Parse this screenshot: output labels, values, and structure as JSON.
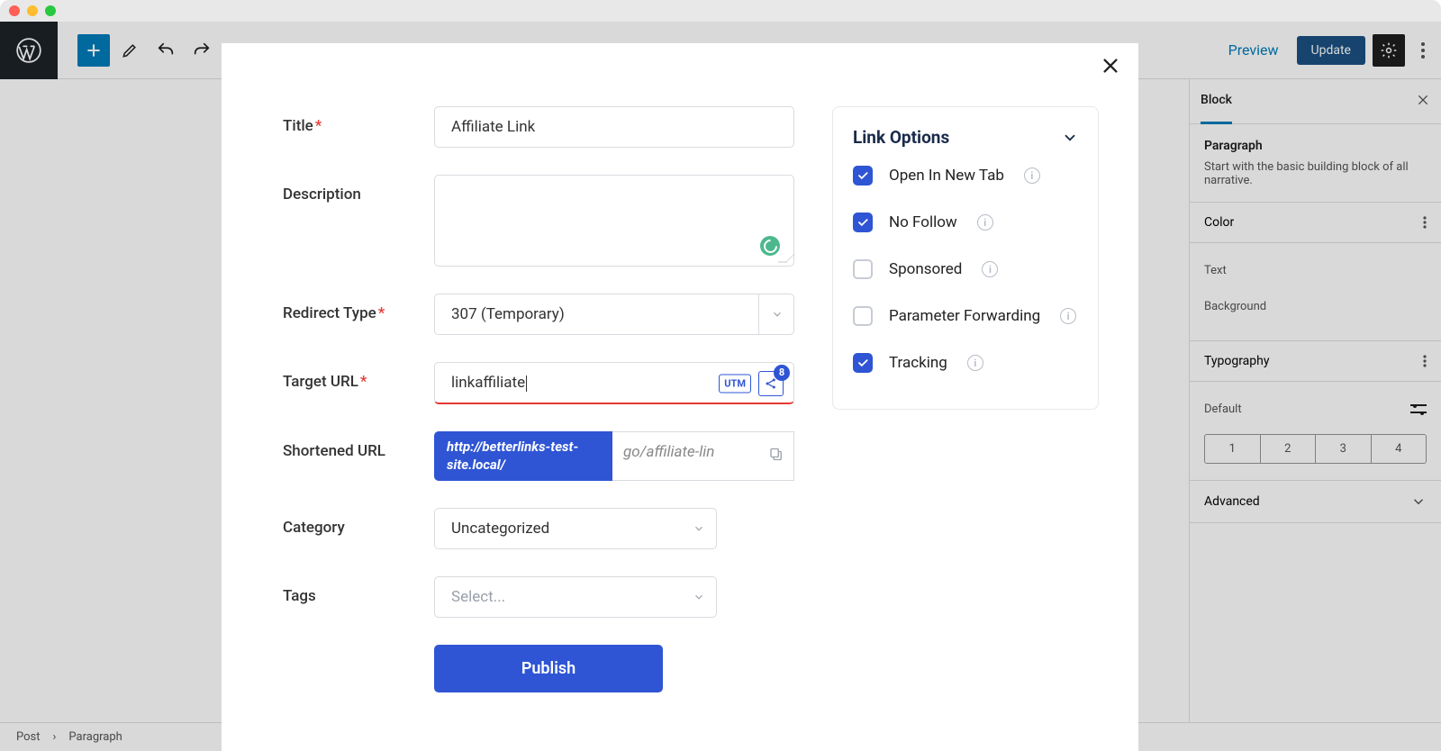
{
  "mac": {},
  "toolbar": {
    "preview": "Preview",
    "update": "Update"
  },
  "sidebar": {
    "tab": "Block",
    "block_title": "Paragraph",
    "block_desc": "Start with the basic building block of all narrative.",
    "panel_color": "Color",
    "color_text": "Text",
    "color_bg": "Background",
    "panel_typo": "Typography",
    "typo_size_default": "Default",
    "sizes": [
      "1",
      "2",
      "3",
      "4"
    ],
    "panel_adv": "Advanced"
  },
  "breadcrumb": {
    "a": "Post",
    "b": "Paragraph"
  },
  "form": {
    "title_label": "Title",
    "title_value": "Affiliate Link",
    "desc_label": "Description",
    "redirect_label": "Redirect Type",
    "redirect_value": "307 (Temporary)",
    "target_label": "Target URL",
    "target_value": "linkaffiliate",
    "utm": "UTM",
    "share_badge": "8",
    "short_label": "Shortened URL",
    "short_base": "http://betterlinks-test-site.local/",
    "short_slug": "go/affiliate-lin",
    "cat_label": "Category",
    "cat_value": "Uncategorized",
    "tags_label": "Tags",
    "tags_placeholder": "Select...",
    "publish": "Publish"
  },
  "options": {
    "heading": "Link Options",
    "items": [
      {
        "label": "Open In New Tab",
        "checked": true
      },
      {
        "label": "No Follow",
        "checked": true
      },
      {
        "label": "Sponsored",
        "checked": false
      },
      {
        "label": "Parameter Forwarding",
        "checked": false
      },
      {
        "label": "Tracking",
        "checked": true
      }
    ]
  }
}
